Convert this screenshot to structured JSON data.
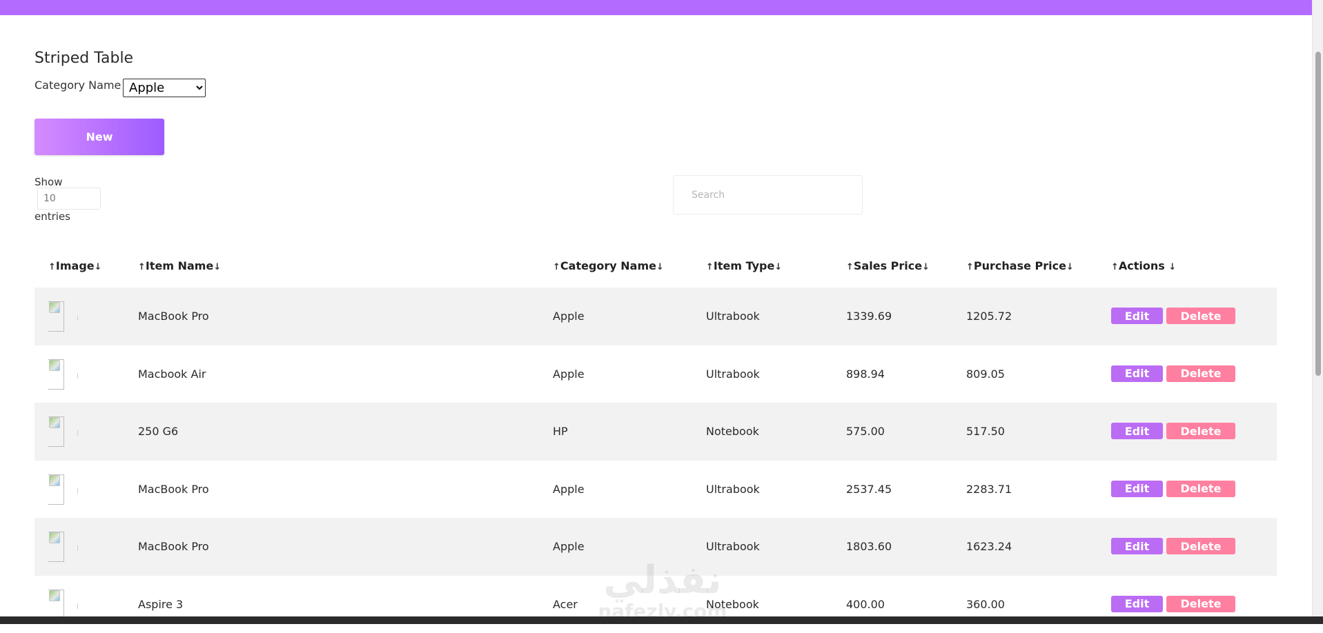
{
  "header": {
    "title": "Striped Table"
  },
  "filter": {
    "label": "Category Name",
    "selected": "Apple"
  },
  "toolbar": {
    "new_label": "New"
  },
  "pagination": {
    "show_label": "Show",
    "entries_value": "",
    "entries_placeholder": "10",
    "entries_label": "entries"
  },
  "search": {
    "placeholder": "Search"
  },
  "table": {
    "columns": [
      "Image",
      "Item Name",
      "Category Name",
      "Item Type",
      "Sales Price",
      "Purchase Price",
      "Actions"
    ],
    "rows": [
      {
        "item_name": "MacBook Pro",
        "category": "Apple",
        "type": "Ultrabook",
        "sales": "1339.69",
        "purchase": "1205.72"
      },
      {
        "item_name": "Macbook Air",
        "category": "Apple",
        "type": "Ultrabook",
        "sales": "898.94",
        "purchase": "809.05"
      },
      {
        "item_name": "250 G6",
        "category": "HP",
        "type": "Notebook",
        "sales": "575.00",
        "purchase": "517.50"
      },
      {
        "item_name": "MacBook Pro",
        "category": "Apple",
        "type": "Ultrabook",
        "sales": "2537.45",
        "purchase": "2283.71"
      },
      {
        "item_name": "MacBook Pro",
        "category": "Apple",
        "type": "Ultrabook",
        "sales": "1803.60",
        "purchase": "1623.24"
      },
      {
        "item_name": "Aspire 3",
        "category": "Acer",
        "type": "Notebook",
        "sales": "400.00",
        "purchase": "360.00"
      }
    ],
    "edit_label": "Edit",
    "delete_label": "Delete",
    "sort_up": "↑",
    "sort_down": "↓"
  },
  "watermark": {
    "arabic": "نفذلي",
    "latin": "nafezly.com"
  },
  "colors": {
    "topbar": "#b36bff",
    "edit": "#bb6cf4",
    "delete": "#ff7fa0",
    "stripe": "#f2f2f2"
  }
}
